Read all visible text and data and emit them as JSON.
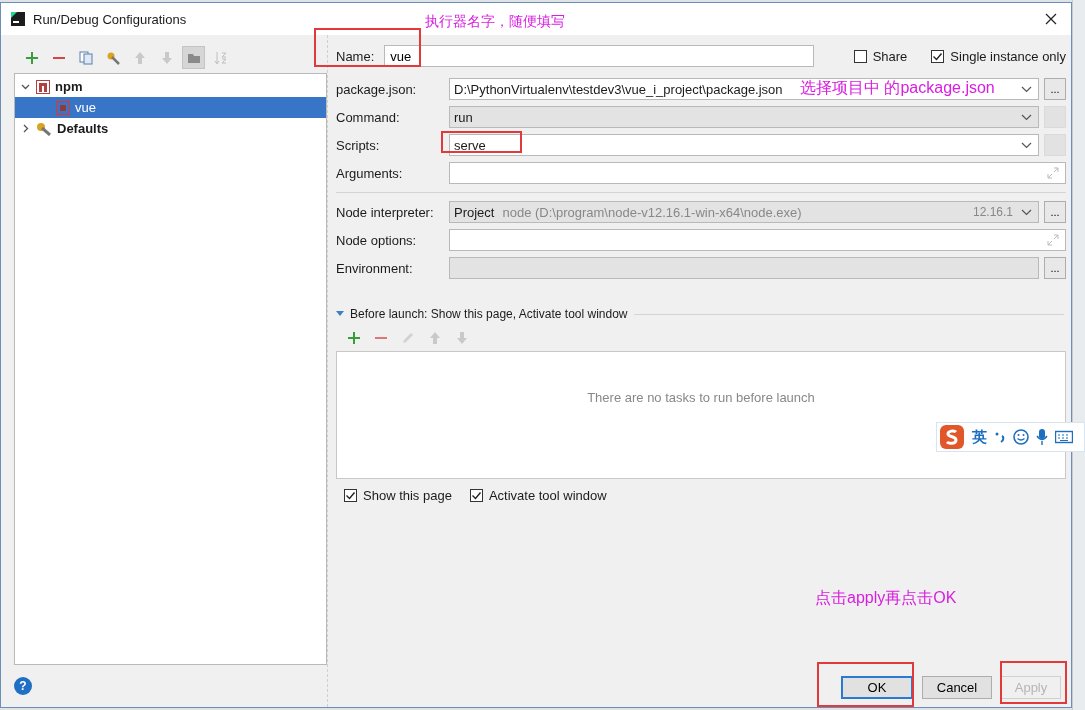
{
  "window": {
    "title": "Run/Debug Configurations"
  },
  "toolbar": [
    {
      "kind": "add",
      "disabled": false
    },
    {
      "kind": "remove",
      "disabled": false
    },
    {
      "kind": "copy",
      "disabled": false
    },
    {
      "kind": "wrench",
      "disabled": false
    },
    {
      "kind": "up",
      "disabled": true
    },
    {
      "kind": "down",
      "disabled": true
    },
    {
      "kind": "folder",
      "disabled": false
    },
    {
      "kind": "sort",
      "disabled": true
    }
  ],
  "tree": [
    {
      "label": "npm",
      "kind": "npm",
      "expanded": true,
      "selected": false,
      "children": [
        {
          "label": "vue",
          "kind": "npm-item",
          "selected": true
        }
      ]
    },
    {
      "label": "Defaults",
      "kind": "defaults",
      "expanded": false,
      "selected": false
    }
  ],
  "name_field": {
    "label": "Name:",
    "value": "vue"
  },
  "header_checks": [
    {
      "label": "Share",
      "checked": false
    },
    {
      "label": "Single instance only",
      "checked": true
    }
  ],
  "fields": [
    {
      "label": "package.json:",
      "kind": "combo",
      "value": "D:\\PythonVirtualenv\\testdev3\\vue_i_project\\package.json",
      "browse": "..."
    },
    {
      "label": "Command:",
      "kind": "readonly-combo",
      "value": "run"
    },
    {
      "label": "Scripts:",
      "kind": "combo",
      "value": "serve"
    },
    {
      "label": "Arguments:",
      "kind": "expand"
    },
    {
      "kind": "separator"
    },
    {
      "label": "Node interpreter:",
      "kind": "interpreter",
      "value": "Project",
      "detail": "node (D:\\program\\node-v12.16.1-win-x64\\node.exe)",
      "version": "12.16.1",
      "browse": "..."
    },
    {
      "label": "Node options:",
      "kind": "expand"
    },
    {
      "label": "Environment:",
      "kind": "disabled-field",
      "browse": "..."
    }
  ],
  "before_launch": {
    "title": "Before launch: Show this page, Activate tool window",
    "expanded": true,
    "toolbar": [
      {
        "kind": "add",
        "disabled": false
      },
      {
        "kind": "remove",
        "disabled": true
      },
      {
        "kind": "edit",
        "disabled": true
      },
      {
        "kind": "up",
        "disabled": true
      },
      {
        "kind": "down",
        "disabled": true
      }
    ],
    "empty_text": "There are no tasks to run before launch"
  },
  "options": [
    {
      "label": "Show this page",
      "checked": true
    },
    {
      "label": "Activate tool window",
      "checked": true
    }
  ],
  "buttons": [
    {
      "label": "OK",
      "default": true,
      "disabled": false
    },
    {
      "label": "Cancel",
      "default": false,
      "disabled": false
    },
    {
      "label": "Apply",
      "default": false,
      "disabled": true
    }
  ],
  "help": "?",
  "ime_toolbar": {
    "language": "英"
  },
  "annotations": [
    {
      "text": "执行器名字，随便填写"
    },
    {
      "text": "选择项目中 的package.json"
    },
    {
      "text": "点击apply再点击OK"
    }
  ]
}
